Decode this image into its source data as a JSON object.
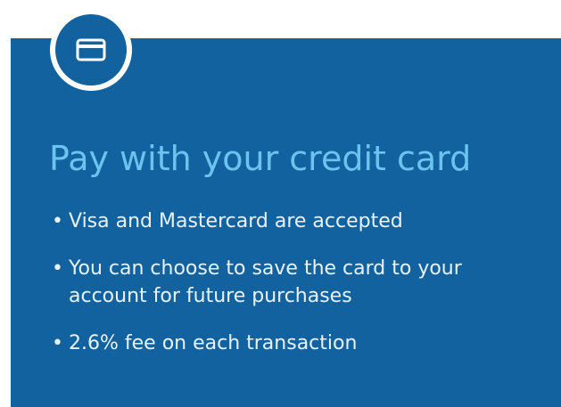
{
  "heading": "Pay with your credit card",
  "bullet_glyph": "•",
  "features": [
    "Visa and Mastercard are accepted",
    "You can choose to save the card to your account for future purchases",
    "2.6% fee on each transaction"
  ],
  "icon": "credit-card-icon",
  "colors": {
    "panel": "#1262a0",
    "heading": "#6cc4ee",
    "text": "#e9f2fa",
    "badge_ring": "#ffffff"
  }
}
